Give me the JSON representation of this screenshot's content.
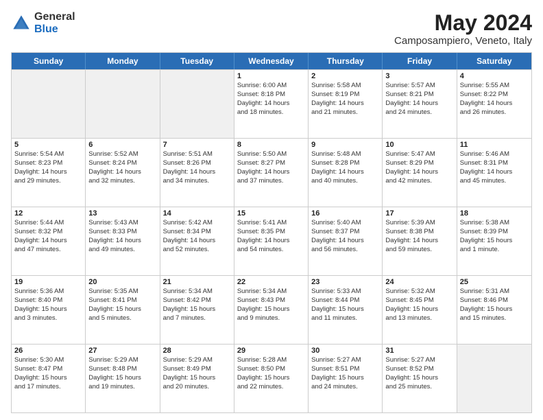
{
  "logo": {
    "general": "General",
    "blue": "Blue"
  },
  "header": {
    "month_year": "May 2024",
    "location": "Camposampiero, Veneto, Italy"
  },
  "days_of_week": [
    "Sunday",
    "Monday",
    "Tuesday",
    "Wednesday",
    "Thursday",
    "Friday",
    "Saturday"
  ],
  "weeks": [
    [
      {
        "day": "",
        "info": []
      },
      {
        "day": "",
        "info": []
      },
      {
        "day": "",
        "info": []
      },
      {
        "day": "1",
        "info": [
          "Sunrise: 6:00 AM",
          "Sunset: 8:18 PM",
          "Daylight: 14 hours",
          "and 18 minutes."
        ]
      },
      {
        "day": "2",
        "info": [
          "Sunrise: 5:58 AM",
          "Sunset: 8:19 PM",
          "Daylight: 14 hours",
          "and 21 minutes."
        ]
      },
      {
        "day": "3",
        "info": [
          "Sunrise: 5:57 AM",
          "Sunset: 8:21 PM",
          "Daylight: 14 hours",
          "and 24 minutes."
        ]
      },
      {
        "day": "4",
        "info": [
          "Sunrise: 5:55 AM",
          "Sunset: 8:22 PM",
          "Daylight: 14 hours",
          "and 26 minutes."
        ]
      }
    ],
    [
      {
        "day": "5",
        "info": [
          "Sunrise: 5:54 AM",
          "Sunset: 8:23 PM",
          "Daylight: 14 hours",
          "and 29 minutes."
        ]
      },
      {
        "day": "6",
        "info": [
          "Sunrise: 5:52 AM",
          "Sunset: 8:24 PM",
          "Daylight: 14 hours",
          "and 32 minutes."
        ]
      },
      {
        "day": "7",
        "info": [
          "Sunrise: 5:51 AM",
          "Sunset: 8:26 PM",
          "Daylight: 14 hours",
          "and 34 minutes."
        ]
      },
      {
        "day": "8",
        "info": [
          "Sunrise: 5:50 AM",
          "Sunset: 8:27 PM",
          "Daylight: 14 hours",
          "and 37 minutes."
        ]
      },
      {
        "day": "9",
        "info": [
          "Sunrise: 5:48 AM",
          "Sunset: 8:28 PM",
          "Daylight: 14 hours",
          "and 40 minutes."
        ]
      },
      {
        "day": "10",
        "info": [
          "Sunrise: 5:47 AM",
          "Sunset: 8:29 PM",
          "Daylight: 14 hours",
          "and 42 minutes."
        ]
      },
      {
        "day": "11",
        "info": [
          "Sunrise: 5:46 AM",
          "Sunset: 8:31 PM",
          "Daylight: 14 hours",
          "and 45 minutes."
        ]
      }
    ],
    [
      {
        "day": "12",
        "info": [
          "Sunrise: 5:44 AM",
          "Sunset: 8:32 PM",
          "Daylight: 14 hours",
          "and 47 minutes."
        ]
      },
      {
        "day": "13",
        "info": [
          "Sunrise: 5:43 AM",
          "Sunset: 8:33 PM",
          "Daylight: 14 hours",
          "and 49 minutes."
        ]
      },
      {
        "day": "14",
        "info": [
          "Sunrise: 5:42 AM",
          "Sunset: 8:34 PM",
          "Daylight: 14 hours",
          "and 52 minutes."
        ]
      },
      {
        "day": "15",
        "info": [
          "Sunrise: 5:41 AM",
          "Sunset: 8:35 PM",
          "Daylight: 14 hours",
          "and 54 minutes."
        ]
      },
      {
        "day": "16",
        "info": [
          "Sunrise: 5:40 AM",
          "Sunset: 8:37 PM",
          "Daylight: 14 hours",
          "and 56 minutes."
        ]
      },
      {
        "day": "17",
        "info": [
          "Sunrise: 5:39 AM",
          "Sunset: 8:38 PM",
          "Daylight: 14 hours",
          "and 59 minutes."
        ]
      },
      {
        "day": "18",
        "info": [
          "Sunrise: 5:38 AM",
          "Sunset: 8:39 PM",
          "Daylight: 15 hours",
          "and 1 minute."
        ]
      }
    ],
    [
      {
        "day": "19",
        "info": [
          "Sunrise: 5:36 AM",
          "Sunset: 8:40 PM",
          "Daylight: 15 hours",
          "and 3 minutes."
        ]
      },
      {
        "day": "20",
        "info": [
          "Sunrise: 5:35 AM",
          "Sunset: 8:41 PM",
          "Daylight: 15 hours",
          "and 5 minutes."
        ]
      },
      {
        "day": "21",
        "info": [
          "Sunrise: 5:34 AM",
          "Sunset: 8:42 PM",
          "Daylight: 15 hours",
          "and 7 minutes."
        ]
      },
      {
        "day": "22",
        "info": [
          "Sunrise: 5:34 AM",
          "Sunset: 8:43 PM",
          "Daylight: 15 hours",
          "and 9 minutes."
        ]
      },
      {
        "day": "23",
        "info": [
          "Sunrise: 5:33 AM",
          "Sunset: 8:44 PM",
          "Daylight: 15 hours",
          "and 11 minutes."
        ]
      },
      {
        "day": "24",
        "info": [
          "Sunrise: 5:32 AM",
          "Sunset: 8:45 PM",
          "Daylight: 15 hours",
          "and 13 minutes."
        ]
      },
      {
        "day": "25",
        "info": [
          "Sunrise: 5:31 AM",
          "Sunset: 8:46 PM",
          "Daylight: 15 hours",
          "and 15 minutes."
        ]
      }
    ],
    [
      {
        "day": "26",
        "info": [
          "Sunrise: 5:30 AM",
          "Sunset: 8:47 PM",
          "Daylight: 15 hours",
          "and 17 minutes."
        ]
      },
      {
        "day": "27",
        "info": [
          "Sunrise: 5:29 AM",
          "Sunset: 8:48 PM",
          "Daylight: 15 hours",
          "and 19 minutes."
        ]
      },
      {
        "day": "28",
        "info": [
          "Sunrise: 5:29 AM",
          "Sunset: 8:49 PM",
          "Daylight: 15 hours",
          "and 20 minutes."
        ]
      },
      {
        "day": "29",
        "info": [
          "Sunrise: 5:28 AM",
          "Sunset: 8:50 PM",
          "Daylight: 15 hours",
          "and 22 minutes."
        ]
      },
      {
        "day": "30",
        "info": [
          "Sunrise: 5:27 AM",
          "Sunset: 8:51 PM",
          "Daylight: 15 hours",
          "and 24 minutes."
        ]
      },
      {
        "day": "31",
        "info": [
          "Sunrise: 5:27 AM",
          "Sunset: 8:52 PM",
          "Daylight: 15 hours",
          "and 25 minutes."
        ]
      },
      {
        "day": "",
        "info": []
      }
    ]
  ]
}
